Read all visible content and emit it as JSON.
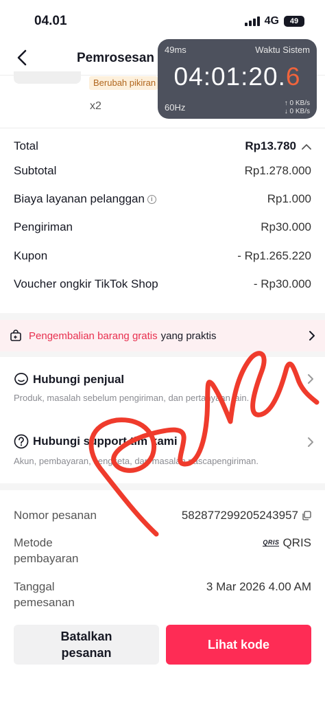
{
  "status_bar": {
    "time": "04.01",
    "network": "4G",
    "battery": "49"
  },
  "header": {
    "title": "Pemrosesan"
  },
  "product": {
    "tag": "Berubah pikiran",
    "quantity": "x2"
  },
  "clock_overlay": {
    "latency": "49ms",
    "label": "Waktu Sistem",
    "time_main": "04:01:20.",
    "time_last_digit": "6",
    "refresh_rate": "60Hz",
    "upload": "↑ 0 KB/s",
    "download": "↓ 0 KB/s",
    "accent_color": "#f0643c"
  },
  "summary": {
    "total_label": "Total",
    "total_value": "Rp13.780",
    "rows": [
      {
        "label": "Subtotal",
        "value": "Rp1.278.000"
      },
      {
        "label": "Biaya layanan pelanggan",
        "value": "Rp1.000"
      },
      {
        "label": "Pengiriman",
        "value": "Rp30.000"
      },
      {
        "label": "Kupon",
        "value": "- Rp1.265.220"
      },
      {
        "label": "Voucher ongkir TikTok Shop",
        "value": "- Rp30.000"
      }
    ]
  },
  "return_banner": {
    "accent_text": "Pengembalian barang gratis",
    "text": "yang praktis",
    "accent_color": "#e8304f"
  },
  "contact": {
    "seller": {
      "title": "Hubungi penjual",
      "subtitle": "Produk, masalah sebelum pengiriman, dan pertanyaan lain."
    },
    "support": {
      "title": "Hubungi support tim kami",
      "subtitle": "Akun, pembayaran, sengketa, dan masalah pascapengiriman."
    }
  },
  "order_info": {
    "order_number_label": "Nomor pesanan",
    "order_number": "582877299205243957",
    "payment_label": "Metode pembayaran",
    "payment_logo": "QRIS",
    "payment_value": "QRIS",
    "date_label": "Tanggal pemesanan",
    "date_value": "3 Mar 2026 4.00 AM"
  },
  "buttons": {
    "cancel": "Batalkan pesanan",
    "view_code": "Lihat kode",
    "primary_color": "#fe2c55"
  }
}
